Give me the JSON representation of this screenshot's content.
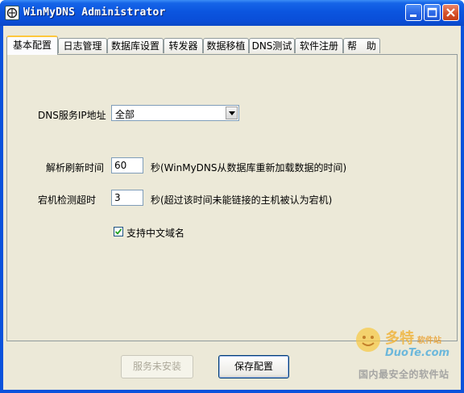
{
  "window": {
    "title": "WinMyDNS Administrator"
  },
  "tabs": [
    {
      "label": "基本配置",
      "active": true
    },
    {
      "label": "日志管理",
      "active": false
    },
    {
      "label": "数据库设置",
      "active": false
    },
    {
      "label": "转发器",
      "active": false
    },
    {
      "label": "数据移植",
      "active": false
    },
    {
      "label": "DNS测试",
      "active": false
    },
    {
      "label": "软件注册",
      "active": false
    },
    {
      "label": "帮　助",
      "active": false
    }
  ],
  "form": {
    "dns_ip_label": "DNS服务IP地址",
    "dns_ip_value": "全部",
    "refresh_label": "解析刷新时间",
    "refresh_value": "60",
    "refresh_hint": "秒(WinMyDNS从数据库重新加载数据的时间)",
    "down_label": "宕机检测超时",
    "down_value": "3",
    "down_hint": "秒(超过该时间未能链接的主机被认为宕机)",
    "chinese_domain_label": "支持中文域名",
    "chinese_domain_checked": true
  },
  "buttons": {
    "service_label": "服务未安装",
    "save_label": "保存配置"
  },
  "watermark": {
    "brand": "多特",
    "brand_sub": "软件站",
    "site": "DuoTe.com",
    "slogan": "国内最安全的软件站"
  }
}
